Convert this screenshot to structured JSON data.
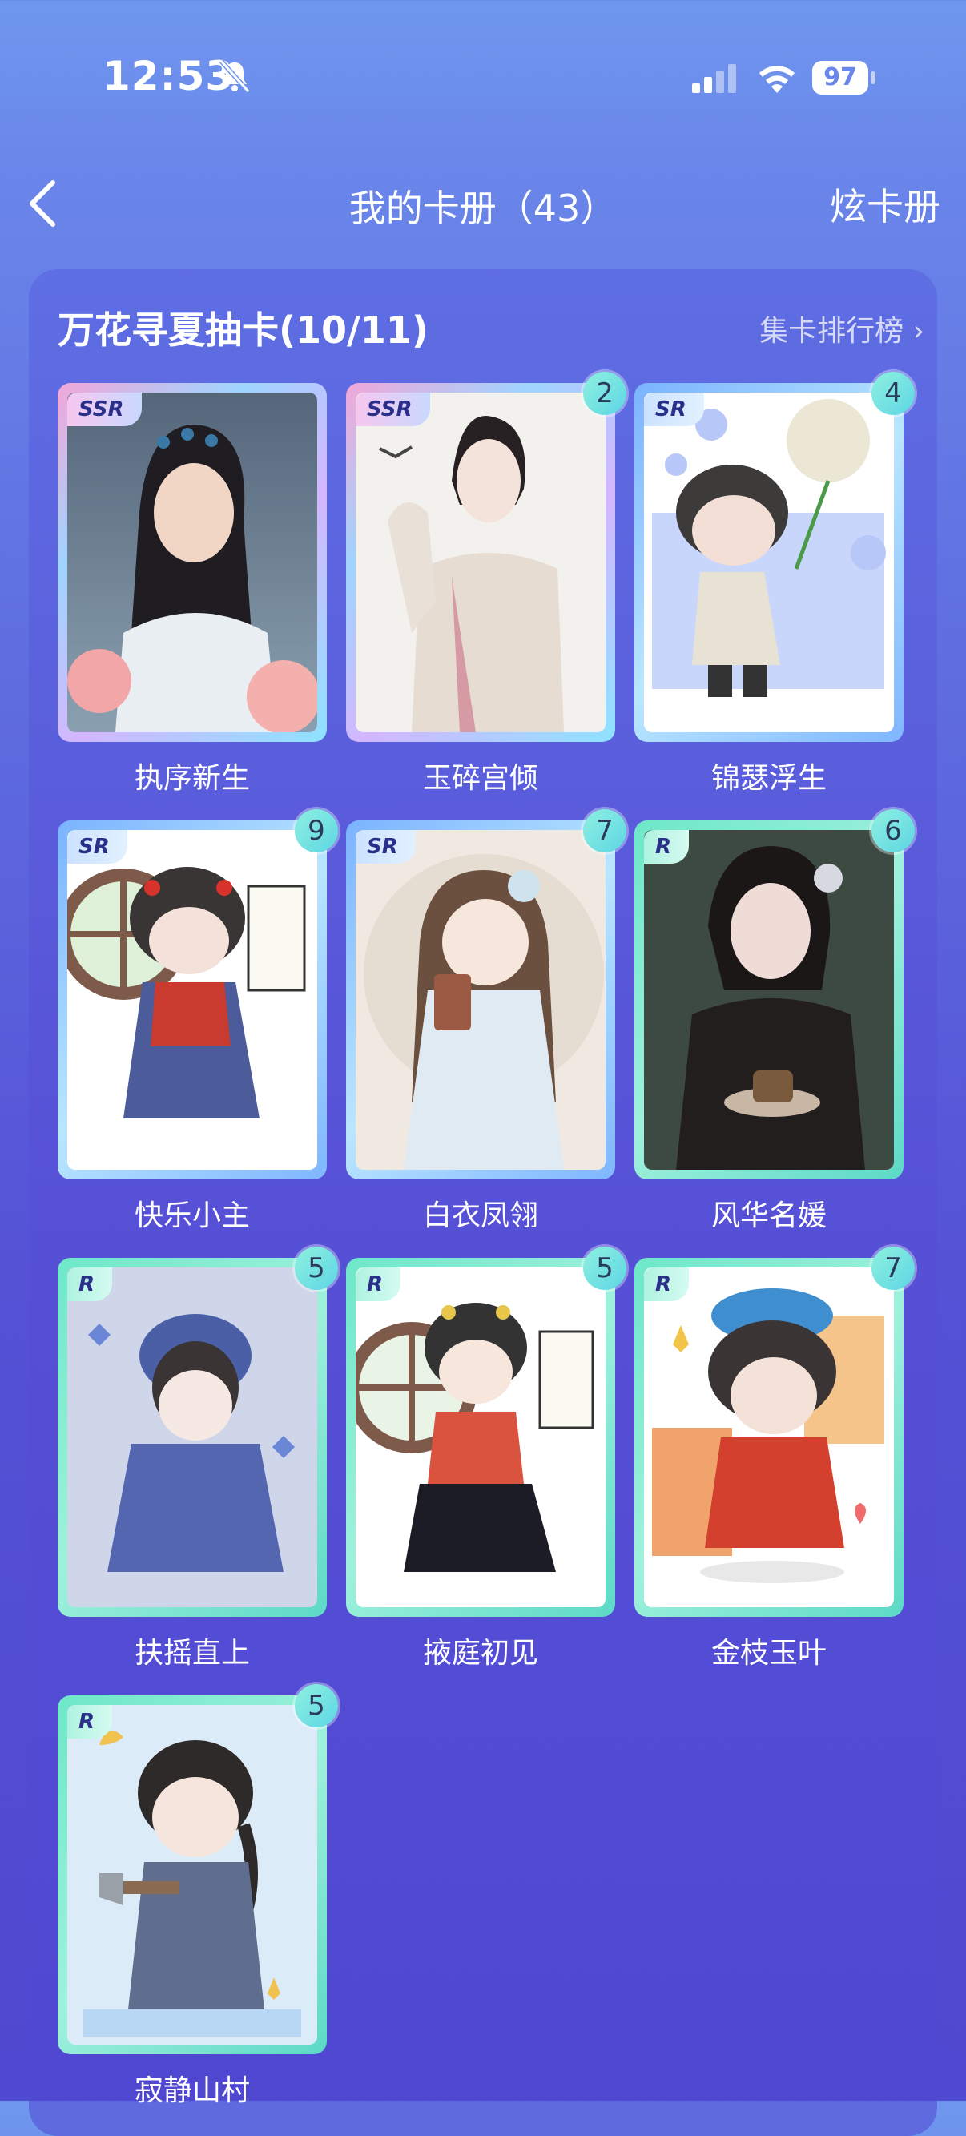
{
  "status_bar": {
    "time": "12:53",
    "battery": "97"
  },
  "nav": {
    "title": "我的卡册（43）",
    "right_action": "炫卡册"
  },
  "section": {
    "title": "万花寻夏抽卡(10/11)",
    "ranking_link": "集卡排行榜"
  },
  "cards": [
    {
      "name": "执序新生",
      "rarity": "SSR",
      "count": ""
    },
    {
      "name": "玉碎宫倾",
      "rarity": "SSR",
      "count": "2"
    },
    {
      "name": "锦瑟浮生",
      "rarity": "SR",
      "count": "4"
    },
    {
      "name": "快乐小主",
      "rarity": "SR",
      "count": "9"
    },
    {
      "name": "白衣凤翎",
      "rarity": "SR",
      "count": "7"
    },
    {
      "name": "风华名媛",
      "rarity": "R",
      "count": "6"
    },
    {
      "name": "扶摇直上",
      "rarity": "R",
      "count": "5"
    },
    {
      "name": "掖庭初见",
      "rarity": "R",
      "count": "5"
    },
    {
      "name": "金枝玉叶",
      "rarity": "R",
      "count": "7"
    },
    {
      "name": "寂静山村",
      "rarity": "R",
      "count": "5"
    }
  ]
}
